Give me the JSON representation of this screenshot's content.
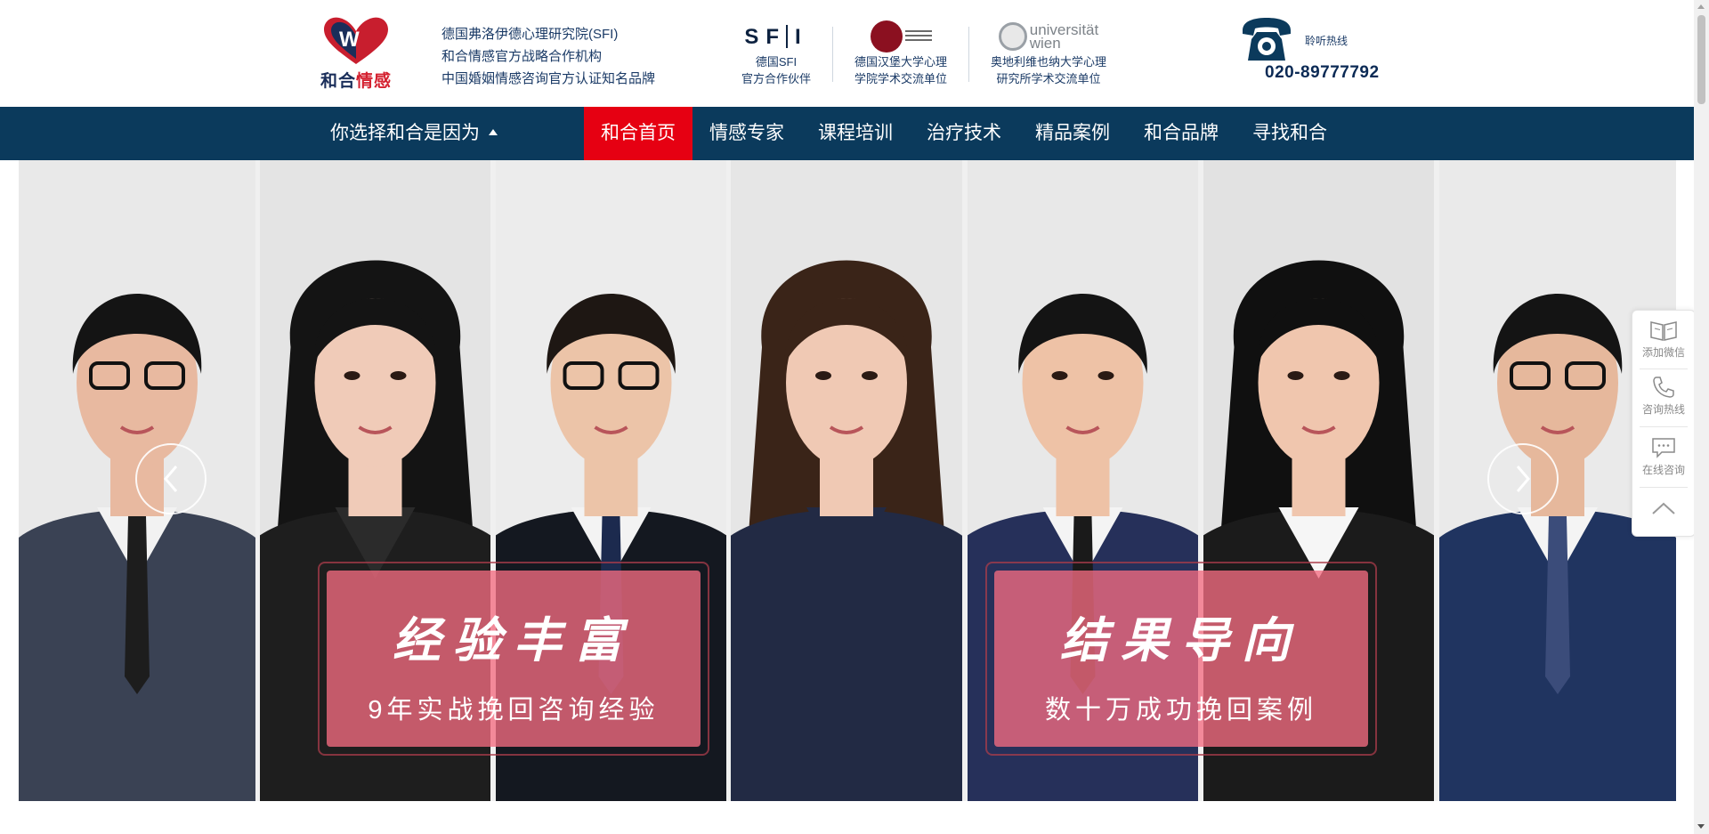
{
  "header": {
    "logo_text_part1": "和合",
    "logo_text_part2": "情感",
    "org_lines": [
      "德国弗洛伊德心理研究院(SFI)",
      "和合情感官方战略合作机构",
      "中国婚姻情感咨询官方认证知名品牌"
    ],
    "partners": [
      {
        "mark": "SFI",
        "line1": "德国SFI",
        "line2": "官方合作伙伴"
      },
      {
        "line1": "德国汉堡大学心理",
        "line2": "学院学术交流单位"
      },
      {
        "mark_line1": "universität",
        "mark_line2": "wien",
        "line1": "奥地利维也纳大学心理",
        "line2": "研究所学术交流单位"
      }
    ],
    "hotline_label": "聆听热线",
    "hotline_number": "020-89777792"
  },
  "nav": {
    "choose_label": "你选择和合是因为",
    "items": [
      "和合首页",
      "情感专家",
      "课程培训",
      "治疗技术",
      "精品案例",
      "和合品牌",
      "寻找和合"
    ],
    "active_index": 0
  },
  "banner": {
    "boxes": [
      {
        "title": "经验丰富",
        "subtitle": "9年实战挽回咨询经验"
      },
      {
        "title": "结果导向",
        "subtitle": "数十万成功挽回案例"
      }
    ]
  },
  "sidebar": {
    "items": [
      {
        "label": "添加微信",
        "icon": "book-icon"
      },
      {
        "label": "咨询热线",
        "icon": "phone-icon"
      },
      {
        "label": "在线咨询",
        "icon": "chat-icon"
      },
      {
        "label": "",
        "icon": "back-to-top-icon"
      }
    ]
  },
  "colors": {
    "nav_bg": "#0b3a5c",
    "nav_active": "#e60012",
    "text_blue": "#1a3a66",
    "box_pink": "#f46c80"
  }
}
